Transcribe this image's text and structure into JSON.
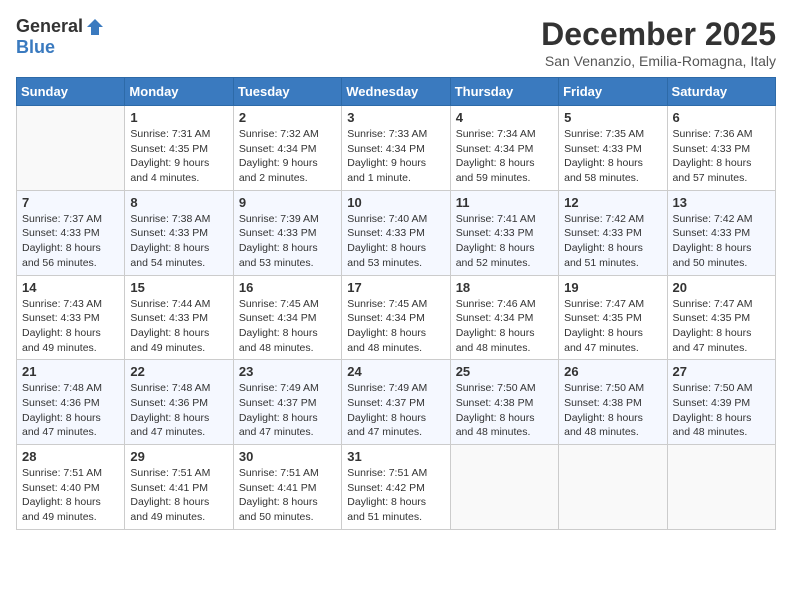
{
  "logo": {
    "general": "General",
    "blue": "Blue"
  },
  "title": "December 2025",
  "subtitle": "San Venanzio, Emilia-Romagna, Italy",
  "headers": [
    "Sunday",
    "Monday",
    "Tuesday",
    "Wednesday",
    "Thursday",
    "Friday",
    "Saturday"
  ],
  "weeks": [
    [
      {
        "day": "",
        "sunrise": "",
        "sunset": "",
        "daylight": ""
      },
      {
        "day": "1",
        "sunrise": "Sunrise: 7:31 AM",
        "sunset": "Sunset: 4:35 PM",
        "daylight": "Daylight: 9 hours and 4 minutes."
      },
      {
        "day": "2",
        "sunrise": "Sunrise: 7:32 AM",
        "sunset": "Sunset: 4:34 PM",
        "daylight": "Daylight: 9 hours and 2 minutes."
      },
      {
        "day": "3",
        "sunrise": "Sunrise: 7:33 AM",
        "sunset": "Sunset: 4:34 PM",
        "daylight": "Daylight: 9 hours and 1 minute."
      },
      {
        "day": "4",
        "sunrise": "Sunrise: 7:34 AM",
        "sunset": "Sunset: 4:34 PM",
        "daylight": "Daylight: 8 hours and 59 minutes."
      },
      {
        "day": "5",
        "sunrise": "Sunrise: 7:35 AM",
        "sunset": "Sunset: 4:33 PM",
        "daylight": "Daylight: 8 hours and 58 minutes."
      },
      {
        "day": "6",
        "sunrise": "Sunrise: 7:36 AM",
        "sunset": "Sunset: 4:33 PM",
        "daylight": "Daylight: 8 hours and 57 minutes."
      }
    ],
    [
      {
        "day": "7",
        "sunrise": "Sunrise: 7:37 AM",
        "sunset": "Sunset: 4:33 PM",
        "daylight": "Daylight: 8 hours and 56 minutes."
      },
      {
        "day": "8",
        "sunrise": "Sunrise: 7:38 AM",
        "sunset": "Sunset: 4:33 PM",
        "daylight": "Daylight: 8 hours and 54 minutes."
      },
      {
        "day": "9",
        "sunrise": "Sunrise: 7:39 AM",
        "sunset": "Sunset: 4:33 PM",
        "daylight": "Daylight: 8 hours and 53 minutes."
      },
      {
        "day": "10",
        "sunrise": "Sunrise: 7:40 AM",
        "sunset": "Sunset: 4:33 PM",
        "daylight": "Daylight: 8 hours and 53 minutes."
      },
      {
        "day": "11",
        "sunrise": "Sunrise: 7:41 AM",
        "sunset": "Sunset: 4:33 PM",
        "daylight": "Daylight: 8 hours and 52 minutes."
      },
      {
        "day": "12",
        "sunrise": "Sunrise: 7:42 AM",
        "sunset": "Sunset: 4:33 PM",
        "daylight": "Daylight: 8 hours and 51 minutes."
      },
      {
        "day": "13",
        "sunrise": "Sunrise: 7:42 AM",
        "sunset": "Sunset: 4:33 PM",
        "daylight": "Daylight: 8 hours and 50 minutes."
      }
    ],
    [
      {
        "day": "14",
        "sunrise": "Sunrise: 7:43 AM",
        "sunset": "Sunset: 4:33 PM",
        "daylight": "Daylight: 8 hours and 49 minutes."
      },
      {
        "day": "15",
        "sunrise": "Sunrise: 7:44 AM",
        "sunset": "Sunset: 4:33 PM",
        "daylight": "Daylight: 8 hours and 49 minutes."
      },
      {
        "day": "16",
        "sunrise": "Sunrise: 7:45 AM",
        "sunset": "Sunset: 4:34 PM",
        "daylight": "Daylight: 8 hours and 48 minutes."
      },
      {
        "day": "17",
        "sunrise": "Sunrise: 7:45 AM",
        "sunset": "Sunset: 4:34 PM",
        "daylight": "Daylight: 8 hours and 48 minutes."
      },
      {
        "day": "18",
        "sunrise": "Sunrise: 7:46 AM",
        "sunset": "Sunset: 4:34 PM",
        "daylight": "Daylight: 8 hours and 48 minutes."
      },
      {
        "day": "19",
        "sunrise": "Sunrise: 7:47 AM",
        "sunset": "Sunset: 4:35 PM",
        "daylight": "Daylight: 8 hours and 47 minutes."
      },
      {
        "day": "20",
        "sunrise": "Sunrise: 7:47 AM",
        "sunset": "Sunset: 4:35 PM",
        "daylight": "Daylight: 8 hours and 47 minutes."
      }
    ],
    [
      {
        "day": "21",
        "sunrise": "Sunrise: 7:48 AM",
        "sunset": "Sunset: 4:36 PM",
        "daylight": "Daylight: 8 hours and 47 minutes."
      },
      {
        "day": "22",
        "sunrise": "Sunrise: 7:48 AM",
        "sunset": "Sunset: 4:36 PM",
        "daylight": "Daylight: 8 hours and 47 minutes."
      },
      {
        "day": "23",
        "sunrise": "Sunrise: 7:49 AM",
        "sunset": "Sunset: 4:37 PM",
        "daylight": "Daylight: 8 hours and 47 minutes."
      },
      {
        "day": "24",
        "sunrise": "Sunrise: 7:49 AM",
        "sunset": "Sunset: 4:37 PM",
        "daylight": "Daylight: 8 hours and 47 minutes."
      },
      {
        "day": "25",
        "sunrise": "Sunrise: 7:50 AM",
        "sunset": "Sunset: 4:38 PM",
        "daylight": "Daylight: 8 hours and 48 minutes."
      },
      {
        "day": "26",
        "sunrise": "Sunrise: 7:50 AM",
        "sunset": "Sunset: 4:38 PM",
        "daylight": "Daylight: 8 hours and 48 minutes."
      },
      {
        "day": "27",
        "sunrise": "Sunrise: 7:50 AM",
        "sunset": "Sunset: 4:39 PM",
        "daylight": "Daylight: 8 hours and 48 minutes."
      }
    ],
    [
      {
        "day": "28",
        "sunrise": "Sunrise: 7:51 AM",
        "sunset": "Sunset: 4:40 PM",
        "daylight": "Daylight: 8 hours and 49 minutes."
      },
      {
        "day": "29",
        "sunrise": "Sunrise: 7:51 AM",
        "sunset": "Sunset: 4:41 PM",
        "daylight": "Daylight: 8 hours and 49 minutes."
      },
      {
        "day": "30",
        "sunrise": "Sunrise: 7:51 AM",
        "sunset": "Sunset: 4:41 PM",
        "daylight": "Daylight: 8 hours and 50 minutes."
      },
      {
        "day": "31",
        "sunrise": "Sunrise: 7:51 AM",
        "sunset": "Sunset: 4:42 PM",
        "daylight": "Daylight: 8 hours and 51 minutes."
      },
      {
        "day": "",
        "sunrise": "",
        "sunset": "",
        "daylight": ""
      },
      {
        "day": "",
        "sunrise": "",
        "sunset": "",
        "daylight": ""
      },
      {
        "day": "",
        "sunrise": "",
        "sunset": "",
        "daylight": ""
      }
    ]
  ]
}
